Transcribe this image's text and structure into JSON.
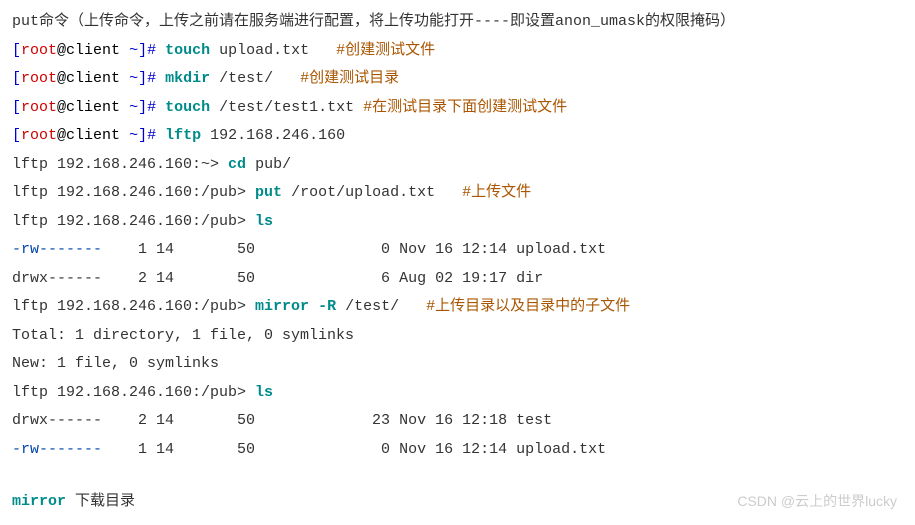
{
  "header_note": "put命令（上传命令，上传之前请在服务端进行配置，将上传功能打开----即设置anon_umask的权限掩码）",
  "prompt": {
    "open_bracket": "[",
    "user": "root",
    "at": "@",
    "host": "client",
    "space_tilde": " ~",
    "bracket_hash": "]# "
  },
  "cmd1": {
    "cmd": "touch",
    "arg": " upload.txt   ",
    "comment": "#创建测试文件"
  },
  "cmd2": {
    "cmd": "mkdir",
    "arg": " /test/   ",
    "comment": "#创建测试目录"
  },
  "cmd3": {
    "cmd": "touch",
    "arg": " /test/test1.txt ",
    "comment": "#在测试目录下面创建测试文件"
  },
  "cmd4": {
    "cmd": "lftp",
    "arg": " 192.168.246.160"
  },
  "lftp1": {
    "prompt": "lftp 192.168.246.160:~> ",
    "cmd": "cd",
    "arg": " pub/"
  },
  "lftp2": {
    "prompt": "lftp 192.168.246.160:/pub> ",
    "cmd": "put",
    "arg": " /root/upload.txt   ",
    "comment": "#上传文件"
  },
  "lftp3": {
    "prompt": "lftp 192.168.246.160:/pub> ",
    "cmd": "ls"
  },
  "ls1_row1": {
    "perm": "-rw-------",
    "rest": "    1 14       50              0 Nov 16 12:14 upload.txt"
  },
  "ls1_row2": {
    "perm": "drwx------",
    "rest": "    2 14       50              6 Aug 02 19:17 dir"
  },
  "lftp4": {
    "prompt": "lftp 192.168.246.160:/pub> ",
    "cmd": "mirror",
    "flag": " -R",
    "arg": " /test/   ",
    "comment": "#上传目录以及目录中的子文件"
  },
  "mirror_out1": "Total: 1 directory, 1 file, 0 symlinks",
  "mirror_out2": "New: 1 file, 0 symlinks",
  "lftp5": {
    "prompt": "lftp 192.168.246.160:/pub> ",
    "cmd": "ls"
  },
  "ls2_row1": {
    "perm": "drwx------",
    "rest": "    2 14       50             23 Nov 16 12:18 test"
  },
  "ls2_row2": {
    "perm": "-rw-------",
    "rest": "    1 14       50              0 Nov 16 12:14 upload.txt"
  },
  "footer": {
    "cmd": "mirror",
    "note": " 下载目录"
  },
  "watermark": "CSDN @云上的世界lucky"
}
